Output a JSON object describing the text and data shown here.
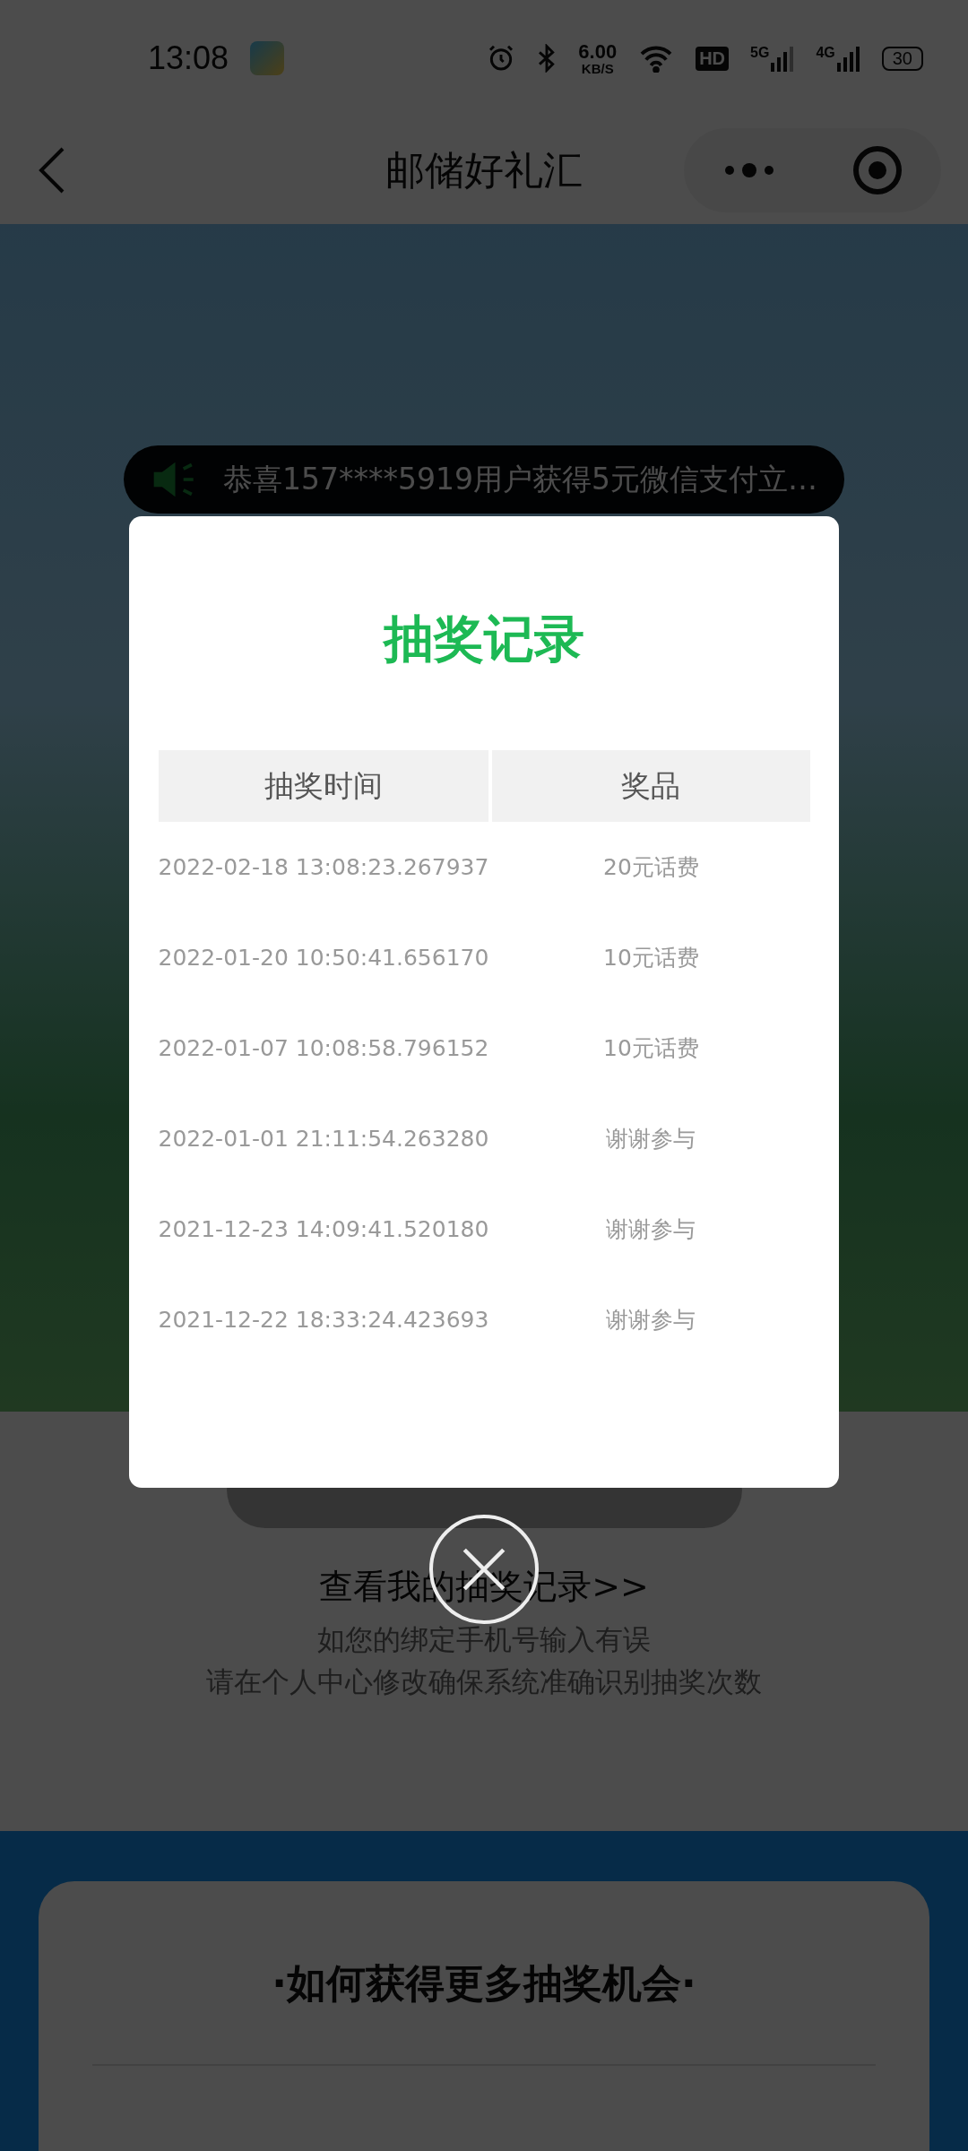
{
  "status_bar": {
    "time": "13:08",
    "net_speed": "6.00",
    "net_speed_unit": "KB/S",
    "hd_label": "HD",
    "signal_labels": [
      "5G",
      "4G"
    ],
    "battery": "30"
  },
  "nav_bar": {
    "title": "邮储好礼汇"
  },
  "notice": {
    "text": "恭喜157****5919用户获得5元微信支付立…"
  },
  "page": {
    "record_link": "查看我的抽奖记录>>",
    "hint_lines": [
      "如您的绑定手机号输入有误",
      "请在个人中心修改确保系统准确识别抽奖次数"
    ]
  },
  "more_chances": {
    "title": "·如何获得更多抽奖机会·"
  },
  "dialog": {
    "title": "抽奖记录",
    "columns": [
      "抽奖时间",
      "奖品"
    ],
    "rows": [
      {
        "time": "2022-02-18 13:08:23.267937",
        "prize": "20元话费"
      },
      {
        "time": "2022-01-20 10:50:41.656170",
        "prize": "10元话费"
      },
      {
        "time": "2022-01-07 10:08:58.796152",
        "prize": "10元话费"
      },
      {
        "time": "2022-01-01 21:11:54.263280",
        "prize": "谢谢参与"
      },
      {
        "time": "2021-12-23 14:09:41.520180",
        "prize": "谢谢参与"
      },
      {
        "time": "2021-12-22 18:33:24.423693",
        "prize": "谢谢参与"
      }
    ]
  }
}
